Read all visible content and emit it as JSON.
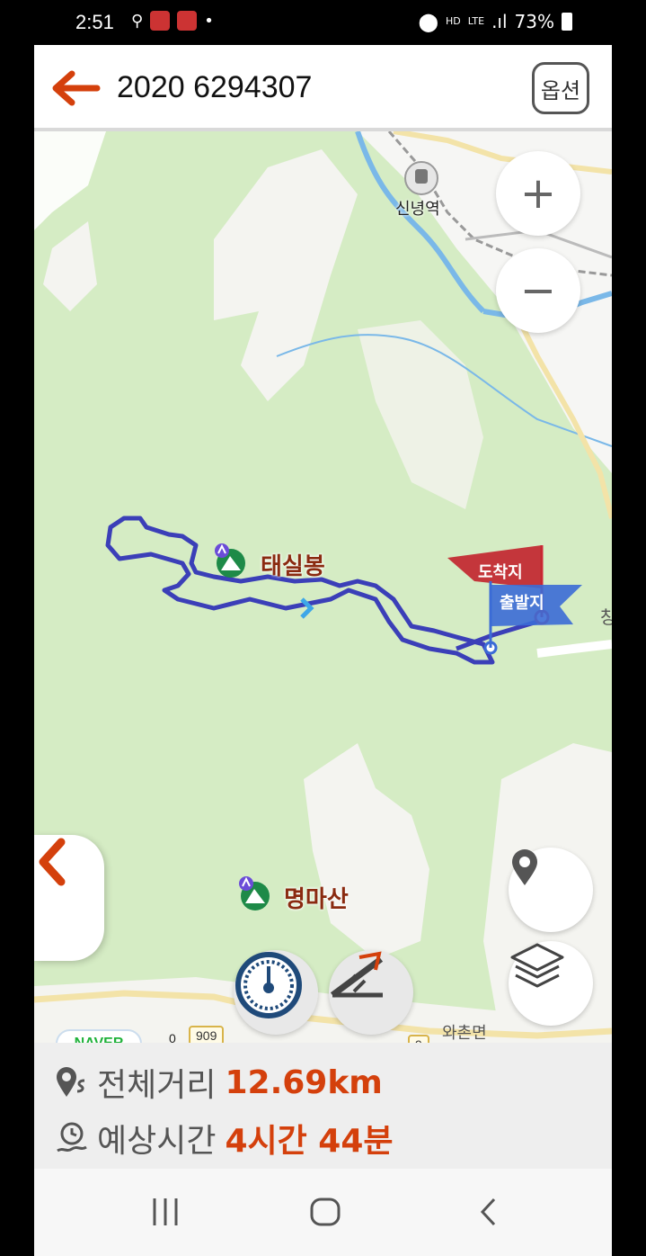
{
  "status_bar": {
    "time": "2:51",
    "hd_voice": "HD",
    "lte": "LTE",
    "battery": "73%"
  },
  "header": {
    "title": "2020 6294307",
    "option_label": "옵션"
  },
  "map": {
    "zoom_in": "+",
    "zoom_out": "−",
    "station": "신녕역",
    "peak1": "태실봉",
    "peak2": "명마산",
    "flag_end": "도착지",
    "flag_start": "출발지",
    "edge_text": "창",
    "town": "와촌면",
    "road_909": "909",
    "road_partial": "9",
    "scale_zero": "0",
    "naver": "NAVER",
    "colors": {
      "route": "#3b3fb8",
      "land": "#d5ecc4",
      "accent": "#d4400c"
    }
  },
  "info": {
    "distance_label": "전체거리",
    "distance_value": "12.69km",
    "time_label": "예상시간",
    "time_value": "4시간 44분"
  }
}
